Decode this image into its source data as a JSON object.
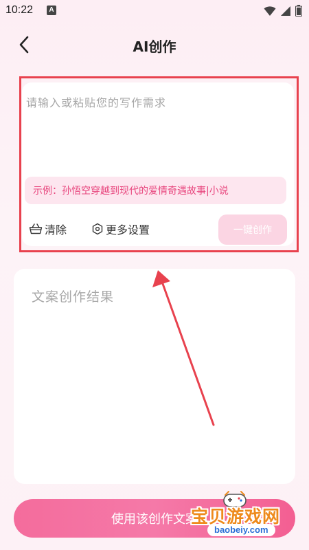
{
  "status_bar": {
    "time": "10:22",
    "notification_icon": "a-letter-icon",
    "right_icons": [
      "wifi-icon",
      "signal-icon",
      "battery-icon"
    ]
  },
  "header": {
    "title": "AI创作",
    "back_icon": "chevron-left-icon"
  },
  "input_card": {
    "placeholder": "请输入或粘贴您的写作需求",
    "value": "",
    "example_text": "示例：孙悟空穿越到现代的爱情奇遇故事|小说",
    "clear_label": "清除",
    "clear_icon": "basket-icon",
    "settings_label": "更多设置",
    "settings_icon": "hexagon-settings-icon",
    "generate_label": "一键创作"
  },
  "result_card": {
    "placeholder": "文案创作结果"
  },
  "bottom": {
    "use_button_label": "使用该创作文案"
  },
  "watermark": {
    "text": "宝贝游戏网",
    "url": "baobeiy.com"
  },
  "colors": {
    "accent_pink": "#f46c9c",
    "example_text": "#e8457d",
    "generate_disabled": "#fbd5e3",
    "annotation_red": "#e8424e",
    "background": "#fdeef4"
  }
}
